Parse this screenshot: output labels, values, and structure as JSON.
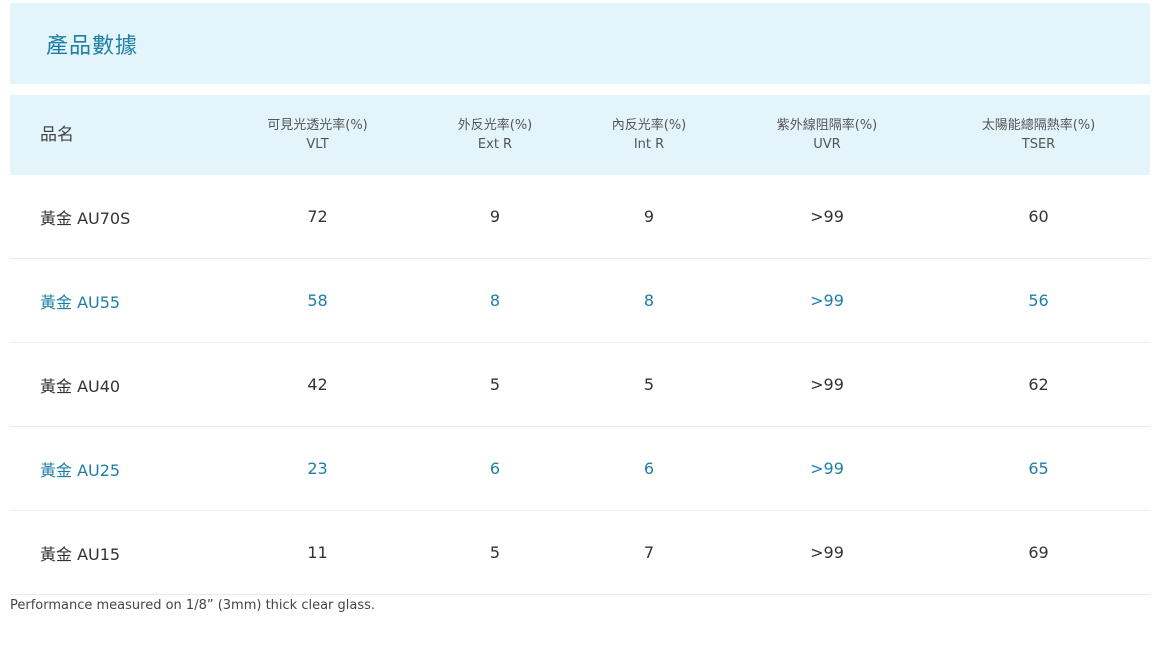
{
  "section": {
    "title": "產品數據"
  },
  "table": {
    "headers": [
      {
        "zh": "品名",
        "en": ""
      },
      {
        "zh": "可見光透光率(%)",
        "en": "VLT"
      },
      {
        "zh": "外反光率(%)",
        "en": "Ext R"
      },
      {
        "zh": "內反光率(%)",
        "en": "Int R"
      },
      {
        "zh": "紫外線阻隔率(%)",
        "en": "UVR"
      },
      {
        "zh": "太陽能總隔熱率(%)",
        "en": "TSER"
      }
    ],
    "rows": [
      {
        "name": "黃金 AU70S",
        "vlt": "72",
        "ext_r": "9",
        "int_r": "9",
        "uvr": ">99",
        "tser": "60",
        "highlighted": false
      },
      {
        "name": "黃金 AU55",
        "vlt": "58",
        "ext_r": "8",
        "int_r": "8",
        "uvr": ">99",
        "tser": "56",
        "highlighted": true
      },
      {
        "name": "黃金 AU40",
        "vlt": "42",
        "ext_r": "5",
        "int_r": "5",
        "uvr": ">99",
        "tser": "62",
        "highlighted": false
      },
      {
        "name": "黃金 AU25",
        "vlt": "23",
        "ext_r": "6",
        "int_r": "6",
        "uvr": ">99",
        "tser": "65",
        "highlighted": true
      },
      {
        "name": "黃金 AU15",
        "vlt": "11",
        "ext_r": "5",
        "int_r": "7",
        "uvr": ">99",
        "tser": "69",
        "highlighted": false
      }
    ]
  },
  "footnote": "Performance measured on 1/8” (3mm) thick clear glass.",
  "colors": {
    "accent": "#1e7fa5",
    "header_bg": "#e3f4fb",
    "text": "#333333"
  }
}
